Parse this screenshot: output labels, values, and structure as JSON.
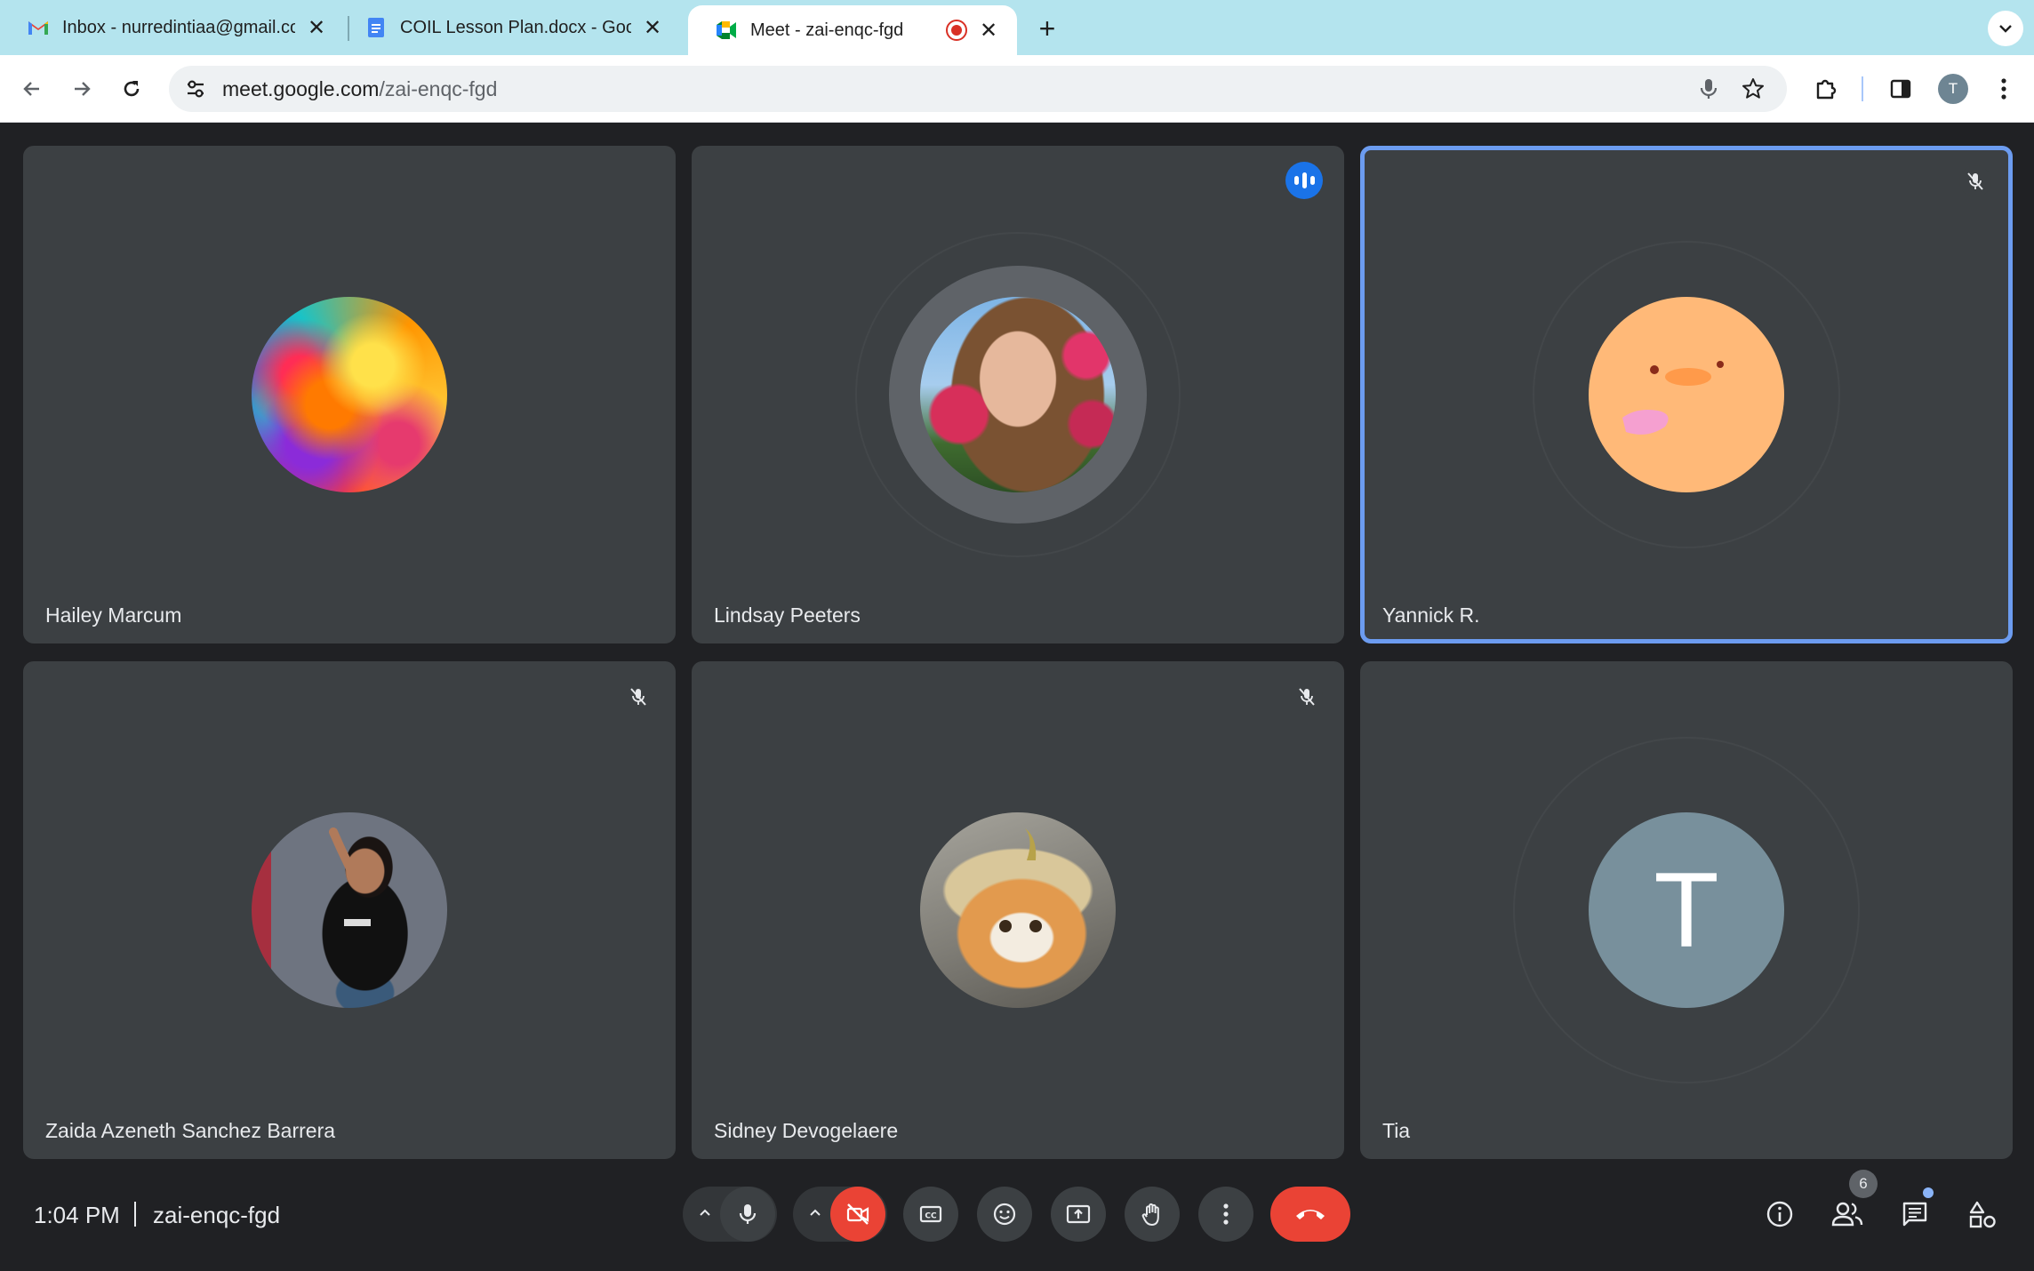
{
  "browser": {
    "tabs": [
      {
        "title": "Inbox - nurredintiaa@gmail.com",
        "favicon": "gmail-icon",
        "active": false
      },
      {
        "title": "COIL Lesson Plan.docx - Google Docs",
        "favicon": "docs-icon",
        "active": false
      },
      {
        "title": "Meet - zai-enqc-fgd",
        "favicon": "meet-icon",
        "active": true,
        "recording": true
      }
    ],
    "url_host": "meet.google.com",
    "url_path": "/zai-enqc-fgd",
    "profile_initial": "T"
  },
  "meeting": {
    "time": "1:04 PM",
    "code": "zai-enqc-fgd",
    "participant_count": "6",
    "participants": [
      {
        "name": "Hailey Marcum",
        "avatar": "colorful-swirl-photo",
        "muted": false,
        "speaking": false
      },
      {
        "name": "Lindsay Peeters",
        "avatar": "woman-with-flowers-photo",
        "muted": false,
        "speaking": true
      },
      {
        "name": "Yannick R.",
        "avatar": "orange-face-drawing",
        "muted": true,
        "speaking": false,
        "pinned": true
      },
      {
        "name": "Zaida Azeneth Sanchez Barrera",
        "avatar": "woman-waving-photo",
        "muted": true,
        "speaking": false
      },
      {
        "name": "Sidney Devogelaere",
        "avatar": "cat-with-hat-photo",
        "muted": true,
        "speaking": false
      },
      {
        "name": "Tia",
        "avatar_initial": "T",
        "muted": false,
        "speaking": false
      }
    ]
  },
  "colors": {
    "accent": "#1a73e8",
    "danger": "#ea4335",
    "tile": "#3c4043",
    "stage": "#202124",
    "pinned_outline": "#6c9cf0",
    "initial_avatar": "#78909c"
  }
}
